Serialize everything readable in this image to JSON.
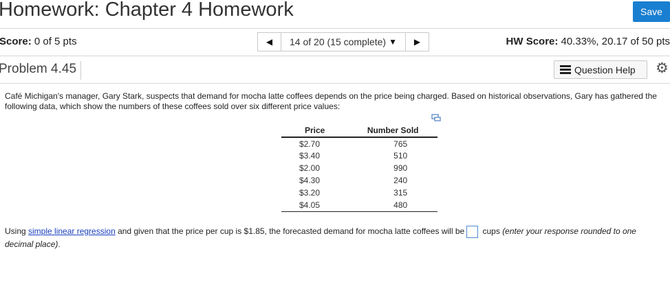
{
  "header": {
    "title": "Homework: Chapter 4 Homework",
    "save_label": "Save"
  },
  "score_bar": {
    "score_label": "Score:",
    "score_value": "0 of 5 pts",
    "nav_text": "14 of 20 (15 complete)",
    "hw_score_label": "HW Score:",
    "hw_score_value": "40.33%, 20.17 of 50 pts"
  },
  "problem": {
    "title": "Problem 4.45",
    "help_label": "Question Help",
    "text": "Café Michigan's manager, Gary Stark, suspects that demand for mocha latte coffees depends on the price being charged.  Based on historical observations, Gary has gathered the following data, which show the numbers of these coffees sold over six different price values:"
  },
  "table": {
    "headers": [
      "Price",
      "Number Sold"
    ],
    "rows": [
      [
        "$2.70",
        "765"
      ],
      [
        "$3.40",
        "510"
      ],
      [
        "$2.00",
        "990"
      ],
      [
        "$4.30",
        "240"
      ],
      [
        "$3.20",
        "315"
      ],
      [
        "$4.05",
        "480"
      ]
    ]
  },
  "question": {
    "prefix": "Using ",
    "link": "simple linear regression",
    "middle": " and given that the price per cup is $1.85, the forecasted demand for mocha latte coffees will be",
    "unit": " cups ",
    "hint": "(enter your response rounded to one decimal place)",
    "suffix": ".",
    "answer_value": ""
  },
  "icons": {
    "nav_prev": "triangle-left-icon",
    "nav_next": "triangle-right-icon",
    "dropdown": "caret-down-icon",
    "help": "list-icon",
    "settings": "gear-icon",
    "copy": "copy-data-icon"
  },
  "colors": {
    "save_button": "#1a7fd1",
    "link": "#1a3fbf",
    "answer_border": "#4a8bd0"
  }
}
